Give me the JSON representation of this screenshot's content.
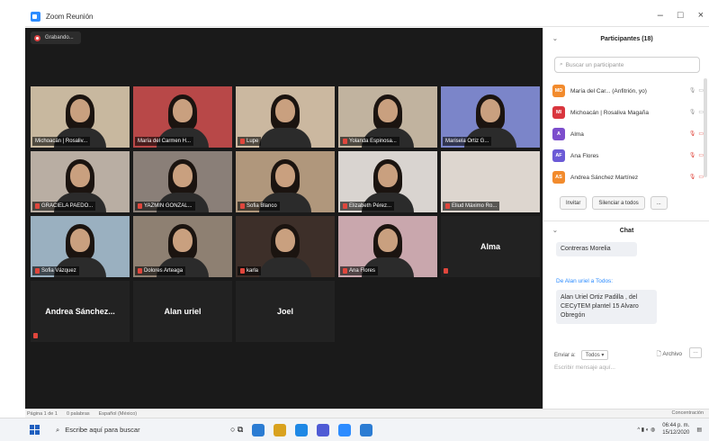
{
  "window": {
    "title": "Zoom Reunión",
    "controls": [
      "–",
      "□",
      "×"
    ]
  },
  "recording": {
    "label": "Grabando..."
  },
  "tiles": [
    {
      "name": "Michoacán | Rosaliv...",
      "active": true,
      "bg": "#c8b89f",
      "face": true,
      "muted": false
    },
    {
      "name": "María del Carmen H...",
      "active": false,
      "bg": "#b84848",
      "face": true,
      "muted": false
    },
    {
      "name": "Lupe",
      "active": false,
      "bg": "#cbb8a0",
      "face": true,
      "muted": true
    },
    {
      "name": "Yolanda Espinosa...",
      "active": false,
      "bg": "#c1b39f",
      "face": true,
      "muted": true
    },
    {
      "name": "Marisela Ortiz G...",
      "active": false,
      "bg": "#7b85c9",
      "face": true,
      "muted": false
    },
    {
      "name": "GRACIELA PAEDO...",
      "active": false,
      "bg": "#b9aea3",
      "face": true,
      "muted": true
    },
    {
      "name": "YAZMIN GONZAL...",
      "active": false,
      "bg": "#8a7f78",
      "face": true,
      "muted": true
    },
    {
      "name": "Sofia Blanco",
      "active": false,
      "bg": "#b0977c",
      "face": true,
      "muted": true
    },
    {
      "name": "Elizabeth Pérez...",
      "active": false,
      "bg": "#d9d4d0",
      "face": true,
      "muted": true
    },
    {
      "name": "Eliud Máximo Ro...",
      "active": false,
      "bg": "#ddd6cf",
      "face": false,
      "muted": true
    },
    {
      "name": "Sofia Vázquez",
      "active": false,
      "bg": "#9ab0c0",
      "face": true,
      "muted": true
    },
    {
      "name": "Dolores Arteaga",
      "active": false,
      "bg": "#8e8072",
      "face": true,
      "muted": true
    },
    {
      "name": "karla",
      "active": false,
      "bg": "#3d2f29",
      "face": true,
      "muted": true
    },
    {
      "name": "Ana Flores",
      "active": false,
      "bg": "#c9a7ad",
      "face": true,
      "muted": true
    },
    {
      "bigname": "Alma",
      "muted": true,
      "nameonly": true
    },
    {
      "bigname": "Andrea Sánchez...",
      "muted": true,
      "nameonly": true
    },
    {
      "bigname": "Alan uriel",
      "muted": false,
      "nameonly": true
    },
    {
      "bigname": "Joel",
      "muted": false,
      "nameonly": true
    }
  ],
  "participants": {
    "title": "Participantes (18)",
    "search_placeholder": "Buscar un participante",
    "items": [
      {
        "initials": "MD",
        "color": "#f28b2d",
        "name": "María del Car... (Anfitrión, yo)",
        "muted": false
      },
      {
        "initials": "MI",
        "color": "#d9363e",
        "name": "Michoacán | Rosaliva Magaña",
        "muted": false
      },
      {
        "initials": "A",
        "color": "#7c4dcc",
        "name": "Alma",
        "muted": true
      },
      {
        "initials": "AF",
        "color": "#6b5ad6",
        "name": "Ana Flores",
        "muted": true
      },
      {
        "initials": "AS",
        "color": "#f28b2d",
        "name": "Andrea Sánchez Martínez",
        "muted": true
      }
    ],
    "invite": "Invitar",
    "mute_all": "Silenciar a todos",
    "more": "..."
  },
  "chat": {
    "title": "Chat",
    "msg1": "Contreras Morelia",
    "from": "De Alan uriel a Todos:",
    "msg2": "Alan Uriel Ortiz Padilla , del CECyTEM plantel 15 Alvaro Obregón",
    "send_to_label": "Enviar a:",
    "send_to_value": "Todos ▾",
    "file_label": "Archivo",
    "compose_placeholder": "Escribir mensaje aquí..."
  },
  "statusbar": {
    "page": "Página 1 de 1",
    "words": "0 palabras",
    "lang": "Español (México)",
    "focus": "Concentración"
  },
  "taskbar": {
    "search_placeholder": "Escribe aquí para buscar",
    "time": "06:44 p. m.",
    "date": "15/12/2020",
    "icons": [
      "#2b7cd3",
      "#d9a21f",
      "#1e88e5",
      "#4f5bd5",
      "#2d8cff",
      "#2b7cd3"
    ]
  }
}
